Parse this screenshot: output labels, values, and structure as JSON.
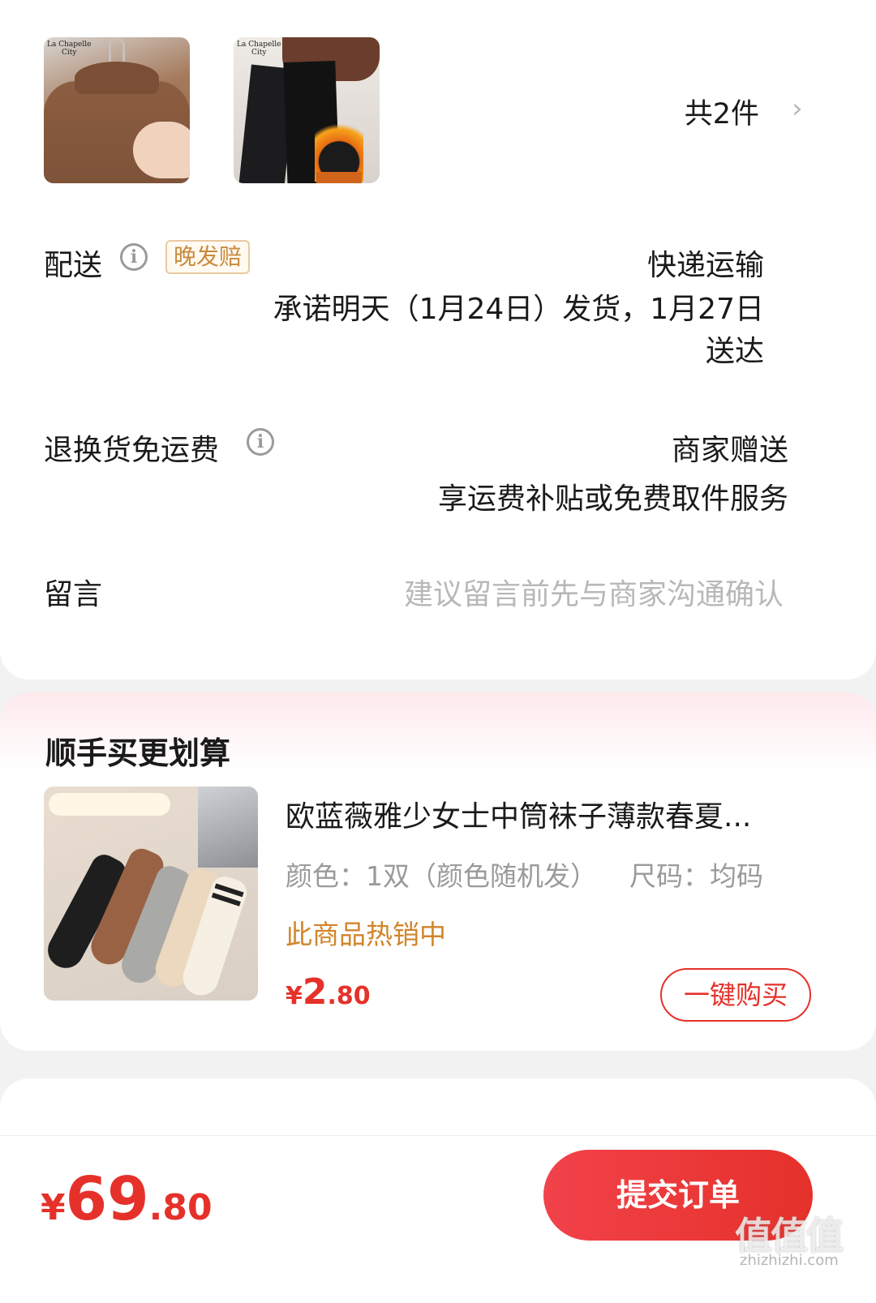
{
  "products_preview": {
    "thumbs": [
      {
        "brand_line1": "La Chapelle",
        "brand_line2": "City"
      },
      {
        "brand_line1": "La Chapelle",
        "brand_line2": "City"
      }
    ],
    "count_label": "共2件",
    "chevron": "›"
  },
  "delivery": {
    "label": "配送",
    "icon": "info-icon",
    "badge": "晚发赔",
    "method": "快递运输",
    "promise_line1": "承诺明天（1月24日）发货，1月27日",
    "promise_line2": "送达"
  },
  "return_shipping": {
    "label": "退换货免运费",
    "icon": "info-icon",
    "value_line1": "商家赠送",
    "value_line2": "享运费补贴或免费取件服务"
  },
  "message": {
    "label": "留言",
    "placeholder": "建议留言前先与商家沟通确认"
  },
  "upsell": {
    "title": "顺手买更划算",
    "product": {
      "title": "欧蓝薇雅少女士中筒袜子薄款春夏...",
      "spec_color": "颜色：1双（颜色随机发）",
      "spec_size": "尺码：均码",
      "hot_label": "此商品热销中",
      "price_symbol": "¥",
      "price_int": "2",
      "price_dec": ".80",
      "buy_label": "一键购买"
    }
  },
  "footer": {
    "price_symbol": "¥",
    "price_int": "69",
    "price_dec": ".80",
    "submit_label": "提交订单"
  },
  "watermark": {
    "main": "值值值",
    "sub": "zhizhizhi.com"
  },
  "colors": {
    "accent_red": "#e5312a",
    "badge_orange": "#c98a3c",
    "hot_orange": "#d1852a"
  }
}
